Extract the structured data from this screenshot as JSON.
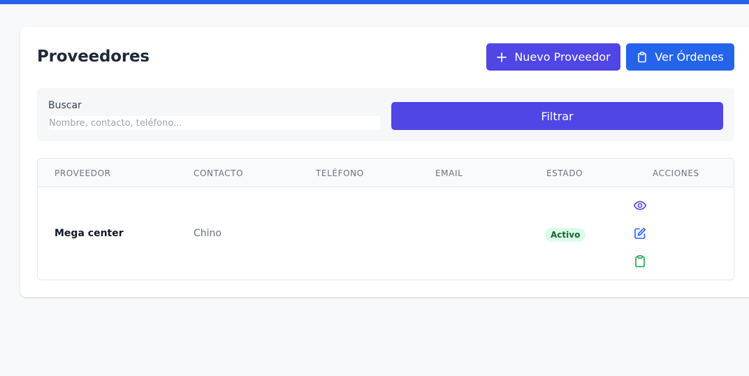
{
  "header": {
    "title": "Proveedores",
    "new_button": "Nuevo Proveedor",
    "orders_button": "Ver Órdenes"
  },
  "filters": {
    "search_label": "Buscar",
    "search_placeholder": "Nombre, contacto, teléfono...",
    "search_value": "",
    "filter_button": "Filtrar"
  },
  "table": {
    "columns": [
      "PROVEEDOR",
      "CONTACTO",
      "TELÉFONO",
      "EMAIL",
      "ESTADO",
      "ACCIONES"
    ],
    "rows": [
      {
        "provider": "Mega center",
        "contact": "Chino",
        "phone": "",
        "email": "",
        "status": "Activo",
        "actions": [
          "eye-icon",
          "edit-icon",
          "clipboard-icon"
        ]
      }
    ]
  },
  "colors": {
    "top_bar": "#2563eb",
    "primary_indigo": "#4f46e5",
    "primary_blue": "#2563eb",
    "status_active_bg": "#dcfce7",
    "status_active_text": "#166534",
    "action_view": "#4f46e5",
    "action_edit": "#2563eb",
    "action_orders": "#16a34a"
  }
}
